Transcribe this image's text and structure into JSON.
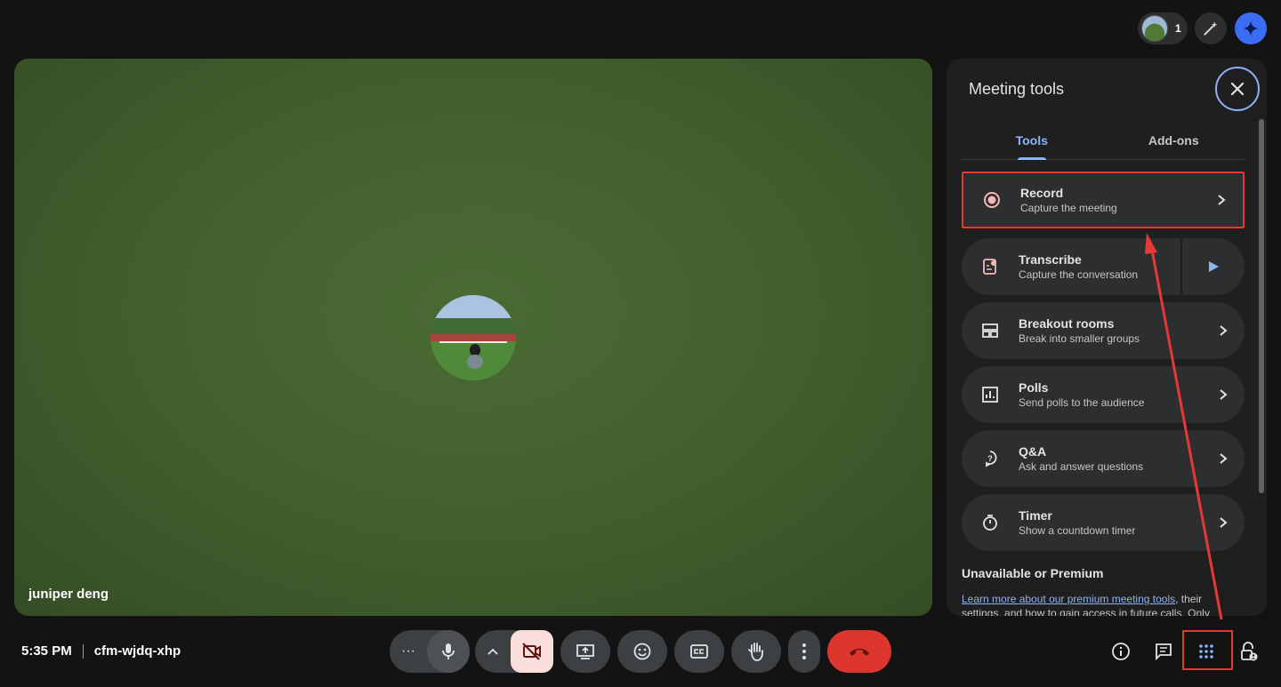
{
  "top_bar": {
    "participant_count": "1",
    "effects_icon": "magic-wand-icon",
    "gemini_icon": "sparkle-icon"
  },
  "video": {
    "participant_name": "juniper deng"
  },
  "panel": {
    "title": "Meeting tools",
    "tabs": [
      {
        "label": "Tools",
        "active": true
      },
      {
        "label": "Add-ons",
        "active": false
      }
    ],
    "tools": [
      {
        "title": "Record",
        "subtitle": "Capture the meeting",
        "icon": "record-icon"
      },
      {
        "title": "Transcribe",
        "subtitle": "Capture the conversation",
        "icon": "transcribe-icon"
      },
      {
        "title": "Breakout rooms",
        "subtitle": "Break into smaller groups",
        "icon": "breakout-rooms-icon"
      },
      {
        "title": "Polls",
        "subtitle": "Send polls to the audience",
        "icon": "polls-icon"
      },
      {
        "title": "Q&A",
        "subtitle": "Ask and answer questions",
        "icon": "qa-icon"
      },
      {
        "title": "Timer",
        "subtitle": "Show a countdown timer",
        "icon": "timer-icon"
      }
    ],
    "unavailable_heading": "Unavailable or Premium",
    "premium_link": "Learn more about our premium meeting tools",
    "premium_text": ", their settings, and how to gain access in future calls. Only"
  },
  "bottom_bar": {
    "time": "5:35 PM",
    "meeting_code": "cfm-wjdq-xhp"
  },
  "colors": {
    "accent": "#8ab4f8",
    "end_call": "#dc362e",
    "annotation": "#e53935"
  }
}
